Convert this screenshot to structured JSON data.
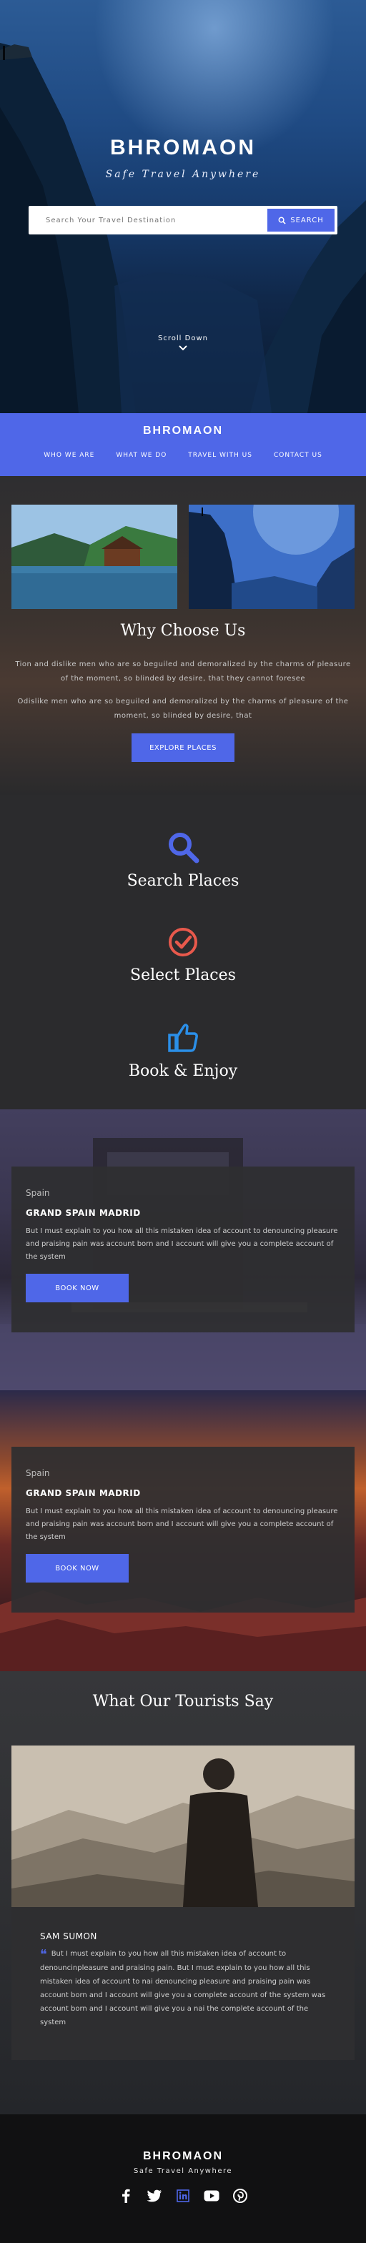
{
  "hero": {
    "brand": "BHROMAON",
    "tagline": "Safe Travel Anywhere",
    "search_placeholder": "Search Your Travel Destination",
    "search_button": "SEARCH",
    "scroll_label": "Scroll Down"
  },
  "nav": {
    "brand": "BHROMAON",
    "items": [
      "WHO WE ARE",
      "WHAT WE DO",
      "TRAVEL WITH US",
      "CONTACT US"
    ]
  },
  "why": {
    "title": "Why Choose Us",
    "paragraph1": "Tion and dislike men who are so beguiled and demoralized by the charms of pleasure of the moment, so blinded by desire, that they cannot foresee",
    "paragraph2": "Odislike men who are so beguiled and demoralized by the charms of pleasure of the moment, so blinded by desire, that",
    "button": "EXPLORE PLACES"
  },
  "features": [
    {
      "label": "Search Places",
      "icon": "search-icon",
      "color": "#4f67e8"
    },
    {
      "label": "Select Places",
      "icon": "check-circle-icon",
      "color": "#e8594c"
    },
    {
      "label": "Book & Enjoy",
      "icon": "thumbs-up-icon",
      "color": "#2b8fe8"
    }
  ],
  "promos": [
    {
      "location": "Spain",
      "title": "GRAND SPAIN MADRID",
      "text": "But I must explain to you how all this mistaken idea of account to denouncing pleasure and praising pain was account  born and I account will give you a complete account of the system",
      "button": "BOOK NOW"
    },
    {
      "location": "Spain",
      "title": "GRAND SPAIN MADRID",
      "text": "But I must explain to you how all this mistaken idea of account to denouncing pleasure and praising pain was account  born and I account will give you a complete account of the system",
      "button": "BOOK NOW"
    }
  ],
  "testimonials": {
    "title": "What Our  Tourists Say",
    "name": "SAM SUMON",
    "quote": "But I must explain to you how all this mistaken idea of account to denouncinpleasure and praising pain. But I must explain to you how all this mistaken idea of account to nai denouncing pleasure and praising pain was account  born and I account will give you a complete account of the system was account  born and I account will give you a nai the complete account of the system"
  },
  "footer": {
    "brand": "BHROMAON",
    "tagline": "Safe Travel Anywhere",
    "social": [
      "facebook-icon",
      "twitter-icon",
      "linkedin-icon",
      "youtube-icon",
      "pinterest-icon"
    ]
  },
  "colors": {
    "accent": "#4f67e8",
    "dark": "#2b2b2d",
    "footer": "#111112"
  }
}
